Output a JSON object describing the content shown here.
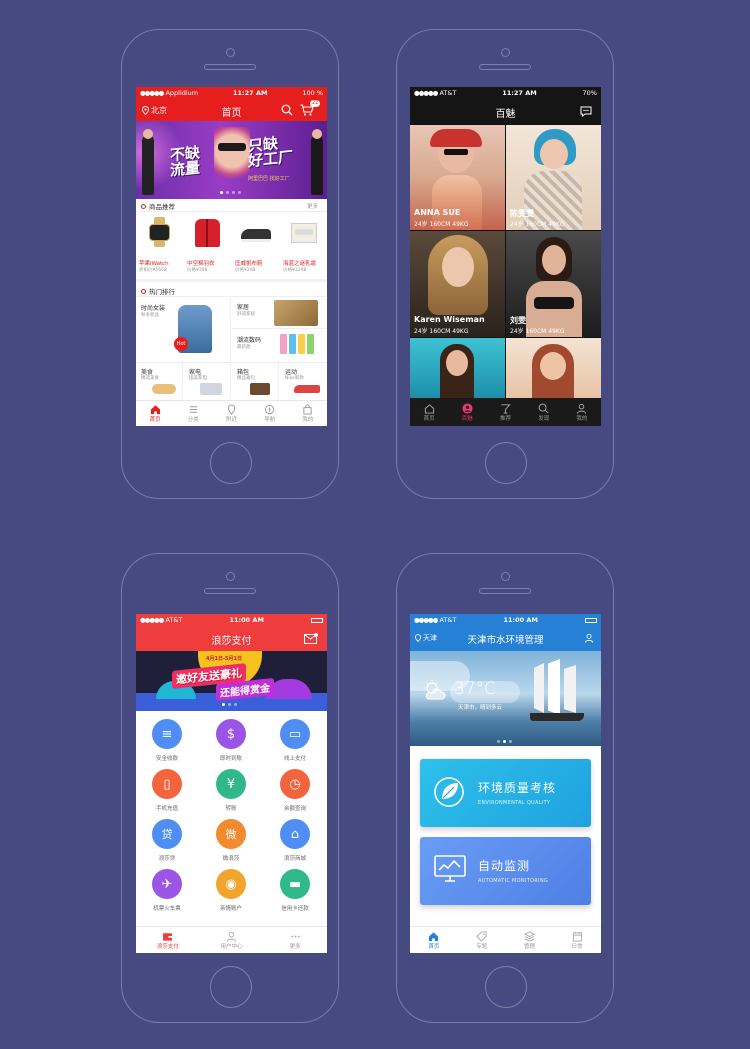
{
  "screen1": {
    "status": {
      "carrier": "Applidium",
      "time": "11:27 AM",
      "battery": "100 %"
    },
    "nav": {
      "location": "北京",
      "title": "首页",
      "cart_badge": "22"
    },
    "banner": {
      "line1": "不缺",
      "line2": "流量",
      "line3": "只缺",
      "line4": "好工厂",
      "sub": "阿里巴巴 找好工厂"
    },
    "recommend": {
      "title": "商品推荐",
      "more": "更多"
    },
    "products": [
      {
        "name": "苹果iWatch",
        "price": "折扣价¥5668"
      },
      {
        "name": "中空棉羽衣",
        "price": "价格¥398"
      },
      {
        "name": "匡威帆布鞋",
        "price": "价格¥298"
      },
      {
        "name": "海蓝之谜乳霜",
        "price": "价格¥1298"
      }
    ],
    "rank": {
      "title": "热门排行"
    },
    "rank_cells": {
      "fashion_women": {
        "name": "时尚女装",
        "sub": "秋冬新品"
      },
      "hot_badge": "Hot",
      "home": {
        "name": "家居",
        "sub": "舒适家居"
      },
      "digital": {
        "name": "潮流数码",
        "sub": "最新款"
      },
      "food": {
        "name": "美食",
        "sub": "精选美食"
      },
      "appliance": {
        "name": "家电",
        "sub": "国美家电"
      },
      "bags": {
        "name": "箱包",
        "sub": "精品箱包"
      },
      "sports": {
        "name": "运动",
        "sub": "Nike新款"
      }
    },
    "tabs": [
      "首页",
      "分类",
      "附近",
      "导航",
      "我的"
    ]
  },
  "screen2": {
    "status": {
      "carrier": "AT&T",
      "time": "11:27 AM",
      "battery": "70%"
    },
    "title": "百魅",
    "models": [
      {
        "name": "ANNA SUE",
        "info": "24岁 160CM 49KG"
      },
      {
        "name": "陈雯雯",
        "info": "24岁 160CM 49KG"
      },
      {
        "name": "Karen Wiseman",
        "info": "24岁 160CM 49KG"
      },
      {
        "name": "刘雯",
        "info": "24岁 160CM 49KG"
      }
    ],
    "tabs": [
      "首页",
      "百魅",
      "推荐",
      "发现",
      "我的"
    ]
  },
  "screen3": {
    "status": {
      "carrier": "AT&T",
      "time": "11:00 AM"
    },
    "title": "浪莎支付",
    "banner": {
      "line1": "邀好友送豪礼",
      "line2": "还能得赏金",
      "date": "4月1日-5月1日"
    },
    "items": [
      "安全收款",
      "即时到账",
      "线上支付",
      "手机充值",
      "转账",
      "余额查询",
      "浪莎贷",
      "微浪莎",
      "浪莎商城",
      "机票火车票",
      "亲情账户",
      "信用卡还款"
    ],
    "icon_glyphs": [
      "≡",
      "$",
      "▭",
      "▯",
      "¥",
      "◷",
      "贷",
      "微",
      "⌂",
      "✈",
      "◉",
      "▬"
    ],
    "tabs": [
      "浪莎支付",
      "用户中心",
      "更多"
    ]
  },
  "screen4": {
    "status": {
      "carrier": "AT&T",
      "time": "11:00 AM"
    },
    "location": "天津",
    "title": "天津市水环境管理",
    "weather": {
      "temp": "37°C",
      "desc": "天津市，晴到多云"
    },
    "cards": [
      {
        "title": "环境质量考核",
        "sub": "ENVIRONMENTAL QUALITY"
      },
      {
        "title": "自动监测",
        "sub": "AUTOMATIC MONITORING"
      }
    ],
    "tabs": [
      "首页",
      "专题",
      "管理",
      "日常"
    ]
  }
}
